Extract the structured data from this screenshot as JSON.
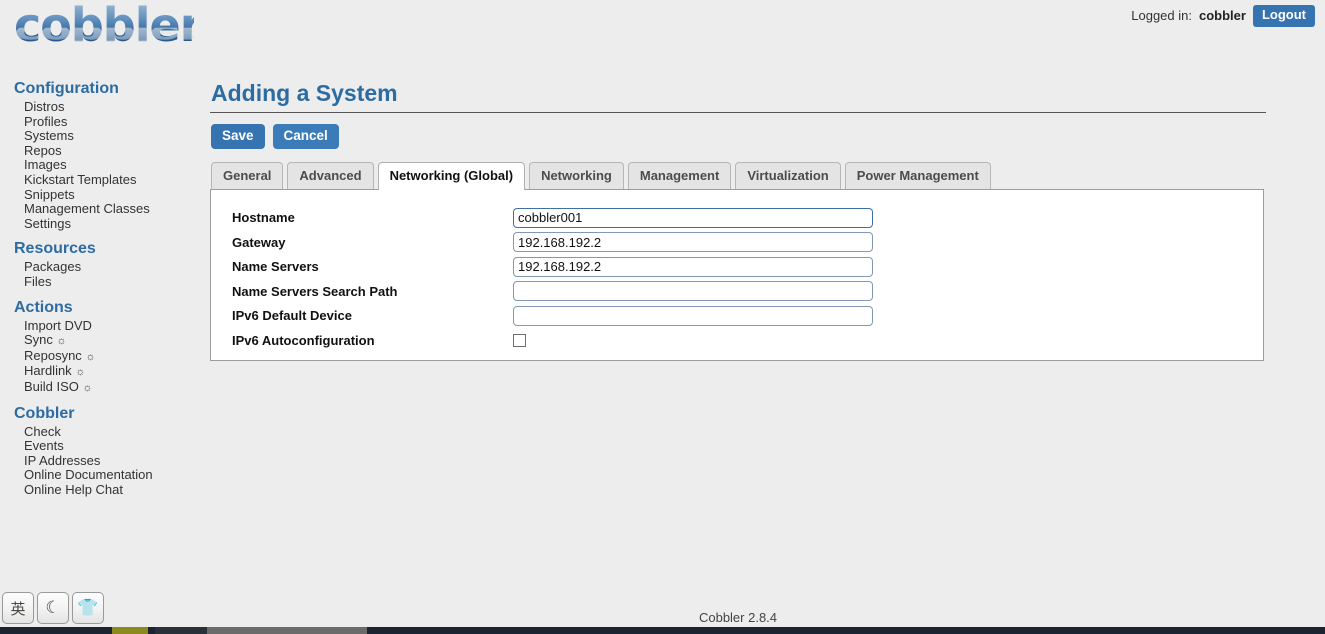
{
  "header": {
    "logo_text": "cobbler",
    "logged_in_label": "Logged in:",
    "username": "cobbler",
    "logout_label": "Logout"
  },
  "sidebar": {
    "sections": [
      {
        "title": "Configuration",
        "items": [
          {
            "label": "Distros",
            "gear": ""
          },
          {
            "label": "Profiles",
            "gear": ""
          },
          {
            "label": "Systems",
            "gear": ""
          },
          {
            "label": "Repos",
            "gear": ""
          },
          {
            "label": "Images",
            "gear": ""
          },
          {
            "label": "Kickstart Templates",
            "gear": ""
          },
          {
            "label": "Snippets",
            "gear": ""
          },
          {
            "label": "Management Classes",
            "gear": ""
          },
          {
            "label": "Settings",
            "gear": ""
          }
        ]
      },
      {
        "title": "Resources",
        "items": [
          {
            "label": "Packages",
            "gear": ""
          },
          {
            "label": "Files",
            "gear": ""
          }
        ]
      },
      {
        "title": "Actions",
        "items": [
          {
            "label": "Import DVD",
            "gear": ""
          },
          {
            "label": "Sync",
            "gear": "☼"
          },
          {
            "label": "Reposync",
            "gear": "☼"
          },
          {
            "label": "Hardlink",
            "gear": "☼"
          },
          {
            "label": "Build ISO",
            "gear": "☼"
          }
        ]
      },
      {
        "title": "Cobbler",
        "items": [
          {
            "label": "Check",
            "gear": ""
          },
          {
            "label": "Events",
            "gear": ""
          },
          {
            "label": "IP Addresses",
            "gear": ""
          },
          {
            "label": "Online Documentation",
            "gear": ""
          },
          {
            "label": "Online Help Chat",
            "gear": ""
          }
        ]
      }
    ]
  },
  "main": {
    "title": "Adding a System",
    "save_label": "Save",
    "cancel_label": "Cancel",
    "tabs": [
      {
        "label": "General",
        "active": false
      },
      {
        "label": "Advanced",
        "active": false
      },
      {
        "label": "Networking (Global)",
        "active": true
      },
      {
        "label": "Networking",
        "active": false
      },
      {
        "label": "Management",
        "active": false
      },
      {
        "label": "Virtualization",
        "active": false
      },
      {
        "label": "Power Management",
        "active": false
      }
    ],
    "fields": [
      {
        "label": "Hostname",
        "type": "text",
        "value": "cobbler001",
        "placeholder": "",
        "focused": true
      },
      {
        "label": "Gateway",
        "type": "text",
        "value": "192.168.192.2",
        "placeholder": "",
        "focused": false
      },
      {
        "label": "Name Servers",
        "type": "text",
        "value": "192.168.192.2",
        "placeholder": "",
        "focused": false
      },
      {
        "label": "Name Servers Search Path",
        "type": "text",
        "value": "",
        "placeholder": "",
        "focused": false
      },
      {
        "label": "IPv6 Default Device",
        "type": "text",
        "value": "",
        "placeholder": "",
        "focused": false
      },
      {
        "label": "IPv6 Autoconfiguration",
        "type": "checkbox",
        "checked": false
      }
    ]
  },
  "footer": {
    "version": "Cobbler 2.8.4"
  },
  "tray": {
    "buttons": [
      {
        "name": "input-method-icon",
        "glyph": "英"
      },
      {
        "name": "moon-icon",
        "glyph": "☾"
      },
      {
        "name": "shirt-icon",
        "glyph": "👕"
      }
    ]
  },
  "colors": {
    "accent_blue": "#2d6ca2",
    "button_blue": "#3573b1",
    "page_bg": "#ededed"
  }
}
